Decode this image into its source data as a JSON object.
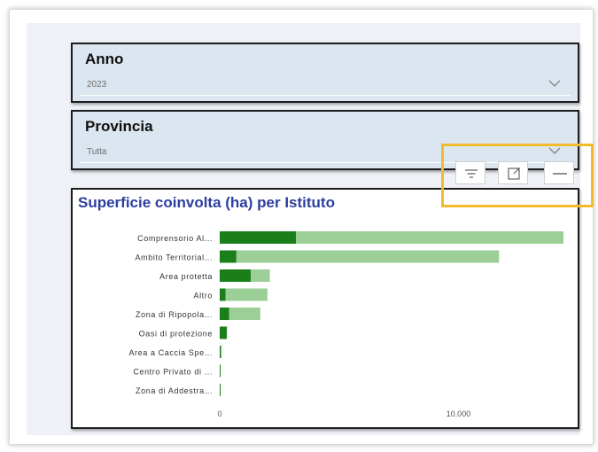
{
  "slicers": {
    "anno": {
      "title": "Anno",
      "value": "2023"
    },
    "provincia": {
      "title": "Provincia",
      "value": "Tutta"
    }
  },
  "toolbar": {
    "filter_icon": "filter-icon",
    "focus_icon": "focus-mode-icon",
    "more_icon": "more-options-icon",
    "highlight_color": "#f2bb2c"
  },
  "colors": {
    "title": "#2c3fa0",
    "bar_dark": "#1a7f1a",
    "bar_light": "#9ccf97",
    "slicer_bg": "#dce6f0"
  },
  "chart_data": {
    "type": "bar",
    "orientation": "horizontal",
    "stacked": true,
    "title": "Superficie coinvolta (ha) per Istituto",
    "categories": [
      "Comprensorio Al...",
      "Ambito Territorial...",
      "Area protetta",
      "Altro",
      "Zona di Ripopola...",
      "Oasi di protezione",
      "Area a Caccia Spe...",
      "Centro Privato di ...",
      "Zona di Addestra..."
    ],
    "series": [
      {
        "values": [
          3200,
          700,
          1300,
          250,
          400,
          300,
          60,
          15,
          15
        ]
      },
      {
        "values": [
          11200,
          11000,
          800,
          1750,
          1300,
          0,
          0,
          0,
          0
        ]
      }
    ],
    "x_ticks": [
      "0",
      "10.000"
    ],
    "xlim": [
      0,
      14400
    ],
    "grid": false,
    "legend": "none"
  }
}
